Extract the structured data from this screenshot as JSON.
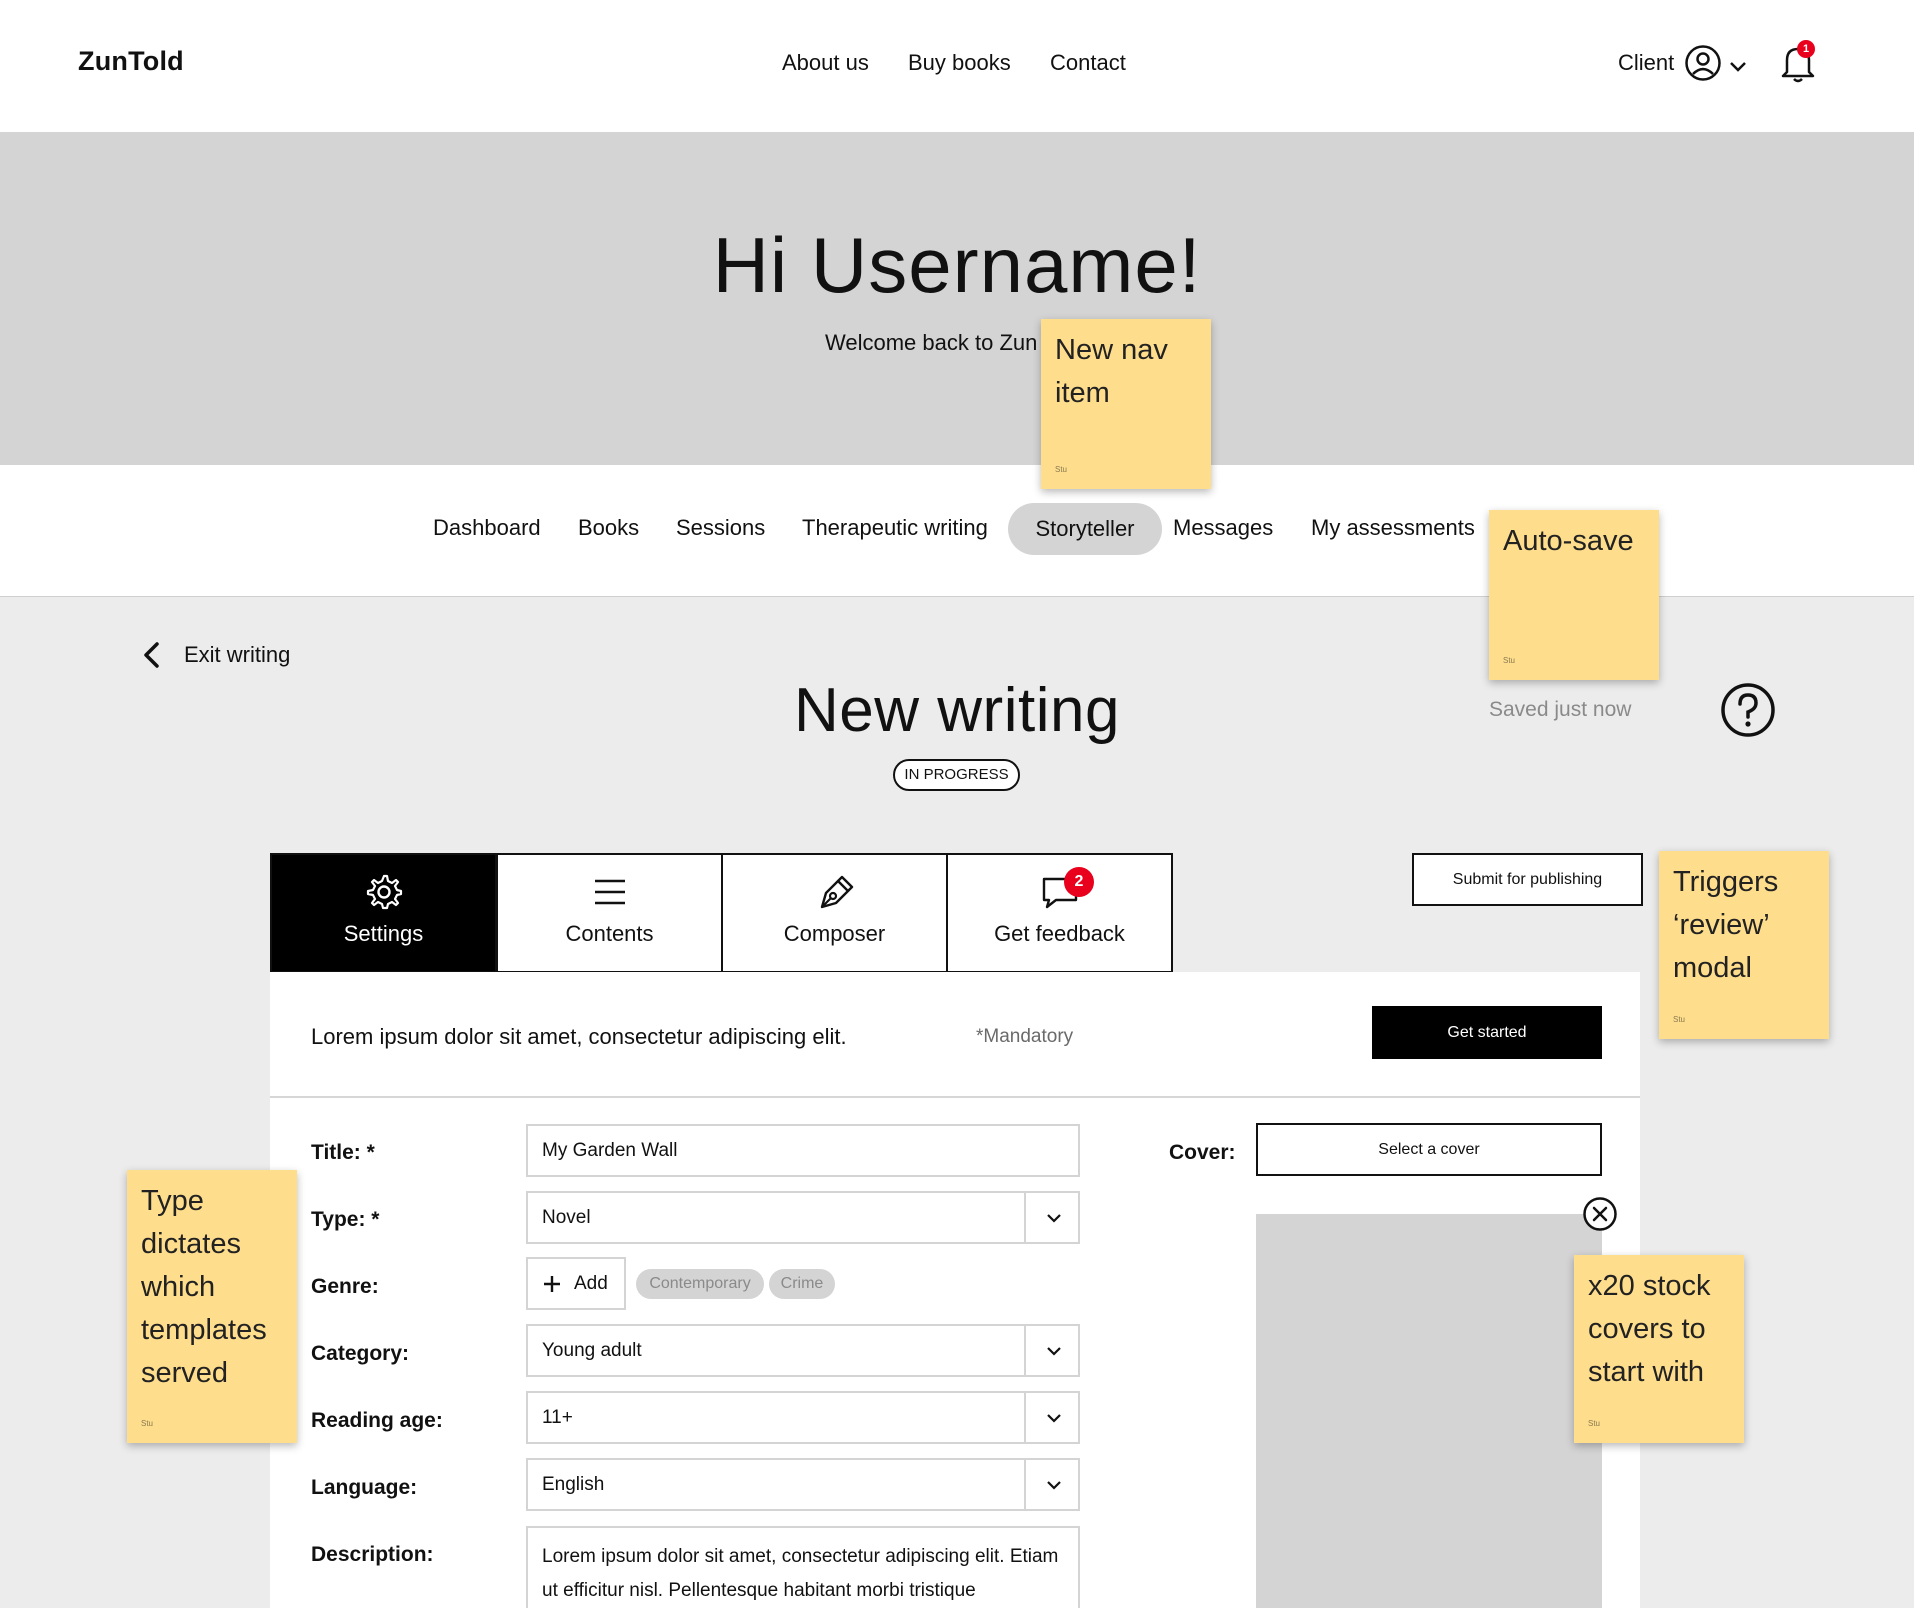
{
  "header": {
    "logo": "ZunTold",
    "nav": [
      "About us",
      "Buy books",
      "Contact"
    ],
    "client_label": "Client",
    "notification_count": "1"
  },
  "hero": {
    "greeting": "Hi Username!",
    "welcome": "Welcome back to Zun"
  },
  "subnav": {
    "items": [
      "Dashboard",
      "Books",
      "Sessions",
      "Therapeutic writing",
      "Storyteller",
      "Messages",
      "My assessments"
    ],
    "active": "Storyteller"
  },
  "writing": {
    "exit_label": "Exit writing",
    "title": "New writing",
    "status": "IN PROGRESS",
    "saved": "Saved just now",
    "submit_label": "Submit for publishing"
  },
  "tabs": [
    {
      "label": "Settings",
      "icon": "gear-icon",
      "active": true
    },
    {
      "label": "Contents",
      "icon": "list-icon",
      "active": false
    },
    {
      "label": "Composer",
      "icon": "pen-icon",
      "active": false
    },
    {
      "label": "Get feedback",
      "icon": "chat-icon",
      "active": false,
      "badge": "2"
    }
  ],
  "panel": {
    "intro": "Lorem ipsum dolor sit amet, consectetur adipiscing elit.",
    "mandatory": "*Mandatory",
    "get_started": "Get started"
  },
  "form": {
    "title_label": "Title: *",
    "title_value": "My Garden Wall",
    "type_label": "Type: *",
    "type_value": "Novel",
    "genre_label": "Genre:",
    "add_label": "Add",
    "genres": [
      "Contemporary",
      "Crime"
    ],
    "category_label": "Category:",
    "category_value": "Young adult",
    "reading_age_label": "Reading age:",
    "reading_age_value": "11+",
    "language_label": "Language:",
    "language_value": "English",
    "description_label": "Description:",
    "description_value": "Lorem ipsum dolor sit amet, consectetur adipiscing elit. Etiam ut efficitur nisl. Pellentesque habitant morbi tristique",
    "cover_label": "Cover:",
    "select_cover": "Select a cover"
  },
  "notes": {
    "nav": "New nav item",
    "autosave": "Auto-save",
    "review": "Triggers ‘review’ modal",
    "type": "Type dictates which templates served",
    "covers": "x20 stock covers to start with",
    "signature": "Stu"
  },
  "colors": {
    "note": "#fedd8c",
    "hero": "#d4d4d4",
    "badge": "#e8001c",
    "page": "#ececec"
  }
}
